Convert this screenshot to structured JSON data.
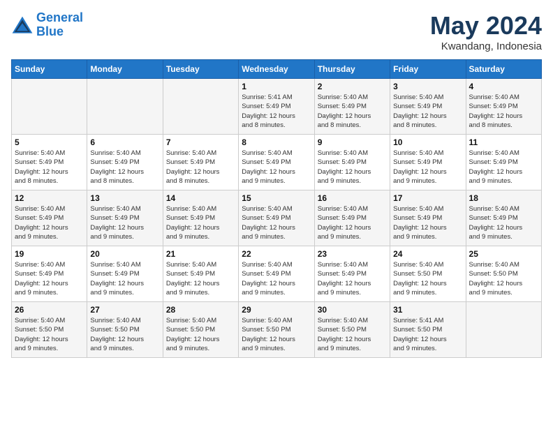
{
  "header": {
    "logo_line1": "General",
    "logo_line2": "Blue",
    "month": "May 2024",
    "location": "Kwandang, Indonesia"
  },
  "days_of_week": [
    "Sunday",
    "Monday",
    "Tuesday",
    "Wednesday",
    "Thursday",
    "Friday",
    "Saturday"
  ],
  "weeks": [
    [
      {
        "day": "",
        "info": ""
      },
      {
        "day": "",
        "info": ""
      },
      {
        "day": "",
        "info": ""
      },
      {
        "day": "1",
        "info": "Sunrise: 5:41 AM\nSunset: 5:49 PM\nDaylight: 12 hours\nand 8 minutes."
      },
      {
        "day": "2",
        "info": "Sunrise: 5:40 AM\nSunset: 5:49 PM\nDaylight: 12 hours\nand 8 minutes."
      },
      {
        "day": "3",
        "info": "Sunrise: 5:40 AM\nSunset: 5:49 PM\nDaylight: 12 hours\nand 8 minutes."
      },
      {
        "day": "4",
        "info": "Sunrise: 5:40 AM\nSunset: 5:49 PM\nDaylight: 12 hours\nand 8 minutes."
      }
    ],
    [
      {
        "day": "5",
        "info": "Sunrise: 5:40 AM\nSunset: 5:49 PM\nDaylight: 12 hours\nand 8 minutes."
      },
      {
        "day": "6",
        "info": "Sunrise: 5:40 AM\nSunset: 5:49 PM\nDaylight: 12 hours\nand 8 minutes."
      },
      {
        "day": "7",
        "info": "Sunrise: 5:40 AM\nSunset: 5:49 PM\nDaylight: 12 hours\nand 8 minutes."
      },
      {
        "day": "8",
        "info": "Sunrise: 5:40 AM\nSunset: 5:49 PM\nDaylight: 12 hours\nand 9 minutes."
      },
      {
        "day": "9",
        "info": "Sunrise: 5:40 AM\nSunset: 5:49 PM\nDaylight: 12 hours\nand 9 minutes."
      },
      {
        "day": "10",
        "info": "Sunrise: 5:40 AM\nSunset: 5:49 PM\nDaylight: 12 hours\nand 9 minutes."
      },
      {
        "day": "11",
        "info": "Sunrise: 5:40 AM\nSunset: 5:49 PM\nDaylight: 12 hours\nand 9 minutes."
      }
    ],
    [
      {
        "day": "12",
        "info": "Sunrise: 5:40 AM\nSunset: 5:49 PM\nDaylight: 12 hours\nand 9 minutes."
      },
      {
        "day": "13",
        "info": "Sunrise: 5:40 AM\nSunset: 5:49 PM\nDaylight: 12 hours\nand 9 minutes."
      },
      {
        "day": "14",
        "info": "Sunrise: 5:40 AM\nSunset: 5:49 PM\nDaylight: 12 hours\nand 9 minutes."
      },
      {
        "day": "15",
        "info": "Sunrise: 5:40 AM\nSunset: 5:49 PM\nDaylight: 12 hours\nand 9 minutes."
      },
      {
        "day": "16",
        "info": "Sunrise: 5:40 AM\nSunset: 5:49 PM\nDaylight: 12 hours\nand 9 minutes."
      },
      {
        "day": "17",
        "info": "Sunrise: 5:40 AM\nSunset: 5:49 PM\nDaylight: 12 hours\nand 9 minutes."
      },
      {
        "day": "18",
        "info": "Sunrise: 5:40 AM\nSunset: 5:49 PM\nDaylight: 12 hours\nand 9 minutes."
      }
    ],
    [
      {
        "day": "19",
        "info": "Sunrise: 5:40 AM\nSunset: 5:49 PM\nDaylight: 12 hours\nand 9 minutes."
      },
      {
        "day": "20",
        "info": "Sunrise: 5:40 AM\nSunset: 5:49 PM\nDaylight: 12 hours\nand 9 minutes."
      },
      {
        "day": "21",
        "info": "Sunrise: 5:40 AM\nSunset: 5:49 PM\nDaylight: 12 hours\nand 9 minutes."
      },
      {
        "day": "22",
        "info": "Sunrise: 5:40 AM\nSunset: 5:49 PM\nDaylight: 12 hours\nand 9 minutes."
      },
      {
        "day": "23",
        "info": "Sunrise: 5:40 AM\nSunset: 5:49 PM\nDaylight: 12 hours\nand 9 minutes."
      },
      {
        "day": "24",
        "info": "Sunrise: 5:40 AM\nSunset: 5:50 PM\nDaylight: 12 hours\nand 9 minutes."
      },
      {
        "day": "25",
        "info": "Sunrise: 5:40 AM\nSunset: 5:50 PM\nDaylight: 12 hours\nand 9 minutes."
      }
    ],
    [
      {
        "day": "26",
        "info": "Sunrise: 5:40 AM\nSunset: 5:50 PM\nDaylight: 12 hours\nand 9 minutes."
      },
      {
        "day": "27",
        "info": "Sunrise: 5:40 AM\nSunset: 5:50 PM\nDaylight: 12 hours\nand 9 minutes."
      },
      {
        "day": "28",
        "info": "Sunrise: 5:40 AM\nSunset: 5:50 PM\nDaylight: 12 hours\nand 9 minutes."
      },
      {
        "day": "29",
        "info": "Sunrise: 5:40 AM\nSunset: 5:50 PM\nDaylight: 12 hours\nand 9 minutes."
      },
      {
        "day": "30",
        "info": "Sunrise: 5:40 AM\nSunset: 5:50 PM\nDaylight: 12 hours\nand 9 minutes."
      },
      {
        "day": "31",
        "info": "Sunrise: 5:41 AM\nSunset: 5:50 PM\nDaylight: 12 hours\nand 9 minutes."
      },
      {
        "day": "",
        "info": ""
      }
    ]
  ]
}
